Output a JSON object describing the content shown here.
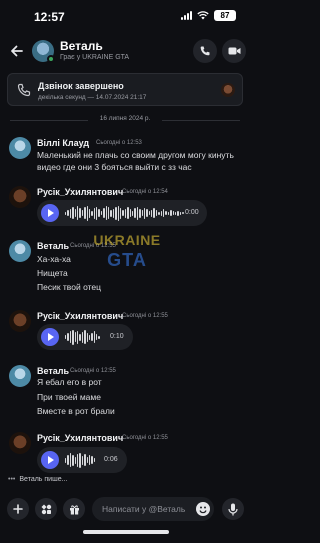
{
  "status_bar": {
    "time": "12:57",
    "battery": "87"
  },
  "header": {
    "title": "Веталь",
    "chevron": "›",
    "subtitle": "Грає у UKRAINE GTA"
  },
  "call": {
    "title": "Дзвінок завершено",
    "subtitle": "декілька секунд — 14.07.2024 21:17"
  },
  "date_divider": "16 липня 2024 р.",
  "watermark": {
    "line1": "UKRAINE",
    "line2": "GTA"
  },
  "messages": [
    {
      "author": "Віллі Клауд",
      "time": "Сьогодні о 12:53",
      "lines": [
        "Маленький не плачь со своим другом могу кинуть",
        "видео где они 3 бояться выйти с зз час"
      ]
    },
    {
      "author": "Русік_Ухилянтович",
      "time": "Сьогодні о 12:54",
      "voice_duration": "0:00"
    },
    {
      "author": "Веталь",
      "time": "Сьогодні о 12:55",
      "lines": [
        "Ха-ха-ха",
        "Нищета",
        "Песик твой отец"
      ]
    },
    {
      "author": "Русік_Ухилянтович",
      "time": "Сьогодні о 12:55",
      "voice_duration": "0:10"
    },
    {
      "author": "Веталь",
      "time": "Сьогодні о 12:55",
      "lines": [
        "Я ебал его в рот",
        "При твоей маме",
        "Вместе в рот брали"
      ]
    },
    {
      "author": "Русік_Ухилянтович",
      "time": "Сьогодні о 12:55",
      "voice_duration": "0:06"
    }
  ],
  "typing": {
    "dots": "•••",
    "text": "Веталь пише..."
  },
  "composer": {
    "placeholder": "Написати у @Веталь"
  },
  "colors": {
    "background": "#0e0f13",
    "accent": "#5865f2",
    "online": "#3ba55d"
  },
  "icons": [
    "back-arrow-icon",
    "phone-icon",
    "video-icon",
    "call-ended-icon",
    "plus-icon",
    "apps-icon",
    "gift-icon",
    "emoji-icon",
    "microphone-icon"
  ]
}
